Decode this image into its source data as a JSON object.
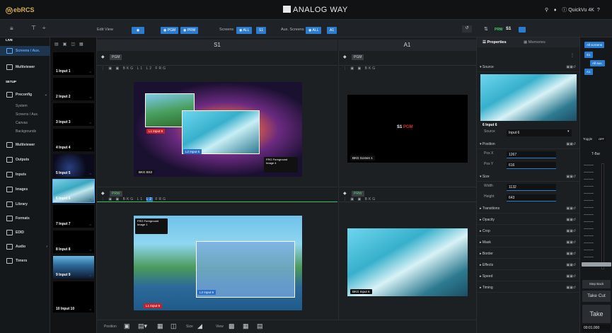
{
  "app": {
    "logo": "ebRCS",
    "logo_initial": "W",
    "brand": "ANALOG WAY",
    "device": "QuickVu 4K"
  },
  "toolbar": {
    "edit_view": "Edit View",
    "pgm": "PGM",
    "prw": "PRW",
    "screens_label": "Screens",
    "all": "ALL",
    "s1": "S1",
    "aux_label": "Aux. Screens",
    "a1": "A1",
    "prw_s1_prefix": "PRW",
    "prw_s1": "S1"
  },
  "sidebar": {
    "live": "LIVE",
    "screens_aux": "Screens / Aux.",
    "multiviewer": "Multiviewer",
    "setup": "SETUP",
    "preconfig": "Preconfig",
    "subs": [
      "System",
      "Screens / Aux.",
      "Canvas",
      "Backgrounds"
    ],
    "multiviewer2": "Multiviewer",
    "outputs": "Outputs",
    "inputs": "Inputs",
    "images": "Images",
    "library": "Library",
    "formats": "Formats",
    "edid": "EDID",
    "audio": "Audio",
    "timers": "Timers"
  },
  "inputs": [
    {
      "label": "1  Input 1"
    },
    {
      "label": "2  Input 2"
    },
    {
      "label": "3  Input 3"
    },
    {
      "label": "4  Input 4"
    },
    {
      "label": "5  Input 5"
    },
    {
      "label": "6  Input 6"
    },
    {
      "label": "7  Input 7"
    },
    {
      "label": "8  Input 8"
    },
    {
      "label": "9  Input 9"
    },
    {
      "label": "10  Input 10"
    }
  ],
  "main": {
    "s1_title": "S1",
    "a1_title": "A1",
    "pgm": "PGM",
    "prw": "PRW",
    "bkg": "BKG",
    "bs2": "BS2",
    "screen1": "Screen 1",
    "input6": "Input 6",
    "l1": "L1",
    "l2": "L2",
    "frg": "FRG",
    "input9": "Input 9",
    "input6b": "Input 6",
    "fg_image4": "Foreground Image 4",
    "fg_image1": "Foreground Image 1",
    "s1pgm_s": "S1",
    "s1pgm_p": "PGM"
  },
  "properties": {
    "tab_props": "Properties",
    "tab_mem": "Memories",
    "source_hdr": "Source",
    "preview_label": "6  Input 6",
    "source_k": "Source",
    "source_v": "Input 6",
    "position_hdr": "Position",
    "posx_k": "Pos X",
    "posx_v": "1267",
    "posy_k": "Pos Y",
    "posy_v": "616",
    "size_hdr": "Size",
    "width_k": "Width",
    "width_v": "1132",
    "height_k": "Height",
    "height_v": "643",
    "sections": [
      "Transitions",
      "Opacity",
      "Crop",
      "Mask",
      "Border",
      "Effects",
      "Speed",
      "Timing"
    ]
  },
  "screens_panel": {
    "all_screens": "All screens",
    "s1": "S1",
    "all_aux": "All aux.",
    "a1": "A1",
    "toggle": "Toggle",
    "off": "OFF",
    "tbar": "T-Bar",
    "step_back": "Step Back",
    "take_cut": "Take Cut",
    "take": "Take",
    "duration": "00:01.000"
  },
  "bottombar": {
    "position": "Position",
    "size": "Size",
    "view": "View"
  }
}
